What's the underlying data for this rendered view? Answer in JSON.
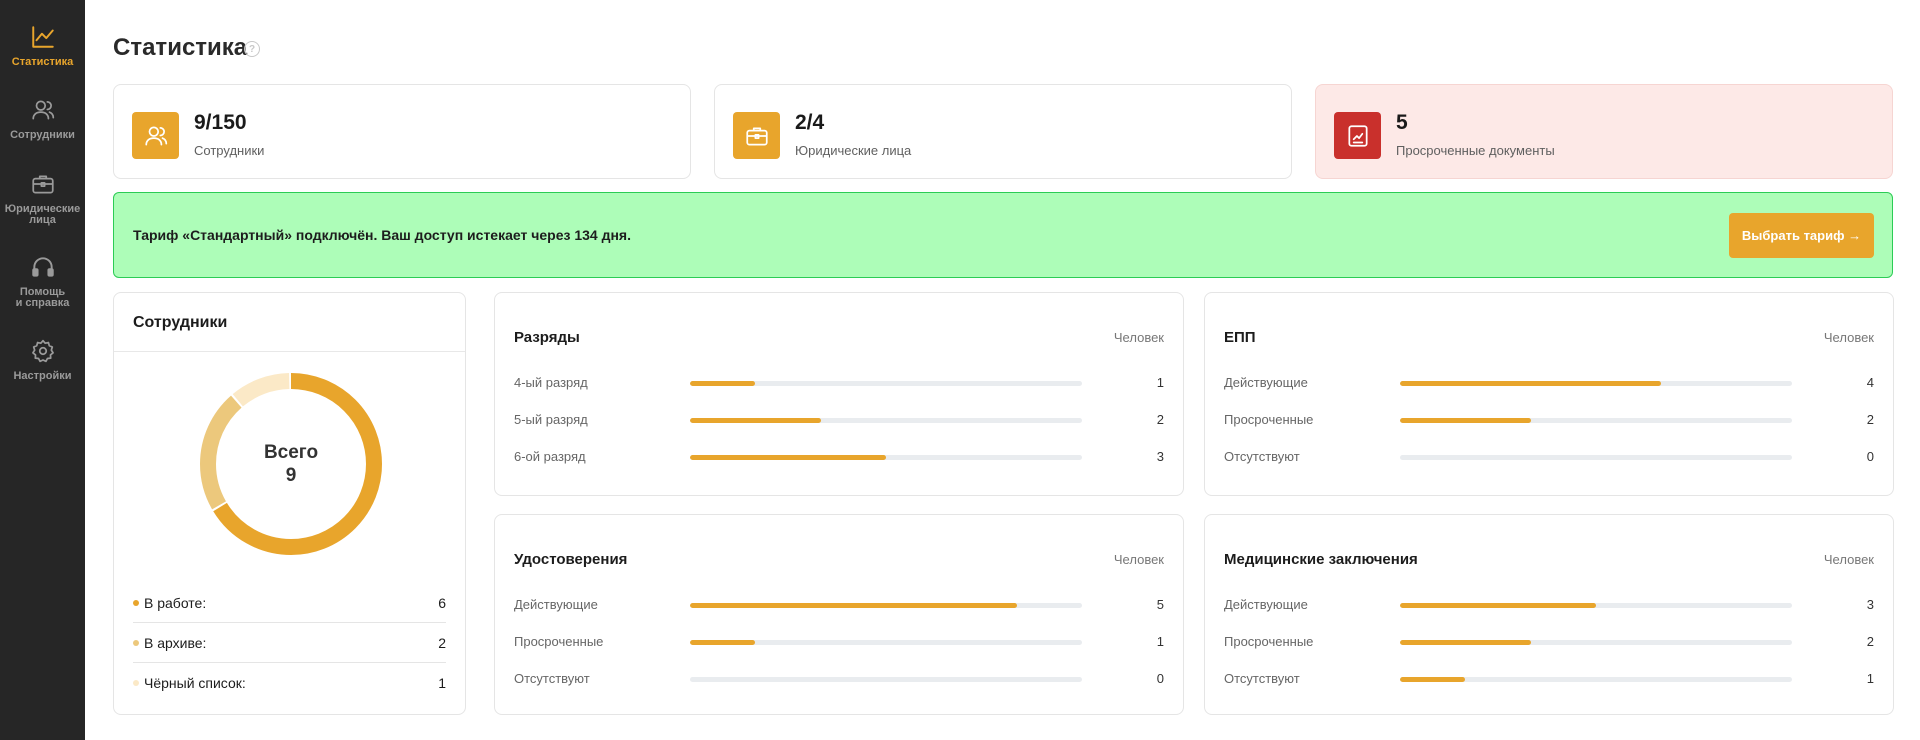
{
  "sidebar": {
    "items": [
      {
        "label": "Статистика",
        "icon": "chart-line-icon",
        "active": true
      },
      {
        "label": "Сотрудники",
        "icon": "users-icon",
        "active": false
      },
      {
        "label": "Юридические\nлица",
        "icon": "briefcase-icon",
        "active": false
      },
      {
        "label": "Помощь\nи справка",
        "icon": "headphones-icon",
        "active": false
      },
      {
        "label": "Настройки",
        "icon": "gear-icon",
        "active": false
      }
    ]
  },
  "page": {
    "title": "Статистика",
    "help": "?"
  },
  "stats": [
    {
      "value": "9/150",
      "label": "Сотрудники",
      "icon": "users-icon"
    },
    {
      "value": "2/4",
      "label": "Юридические лица",
      "icon": "briefcase-icon"
    },
    {
      "value": "5",
      "label": "Просроченные документы",
      "icon": "document-alert-icon"
    }
  ],
  "banner": {
    "text": "Тариф «Стандартный» подключён. Ваш доступ истекает через 134 дня.",
    "button": "Выбрать тариф →"
  },
  "employees": {
    "title": "Сотрудники",
    "total_label": "Всего",
    "total": 9,
    "legend": [
      {
        "label": "В работе:",
        "value": 6,
        "color": "#e8a52c"
      },
      {
        "label": "В архиве:",
        "value": 2,
        "color": "#ecc87c"
      },
      {
        "label": "Чёрный список:",
        "value": 1,
        "color": "#fbe9c7"
      }
    ]
  },
  "cards": [
    {
      "title": "Разряды",
      "unit": "Человек",
      "max": 6,
      "rows": [
        {
          "label": "4-ый разряд",
          "value": 1
        },
        {
          "label": "5-ый разряд",
          "value": 2
        },
        {
          "label": "6-ой разряд",
          "value": 3
        }
      ]
    },
    {
      "title": "ЕПП",
      "unit": "Человек",
      "max": 6,
      "rows": [
        {
          "label": "Действующие",
          "value": 4
        },
        {
          "label": "Просроченные",
          "value": 2
        },
        {
          "label": "Отсутствуют",
          "value": 0
        }
      ]
    },
    {
      "title": "Удостоверения",
      "unit": "Человек",
      "max": 6,
      "rows": [
        {
          "label": "Действующие",
          "value": 5
        },
        {
          "label": "Просроченные",
          "value": 1
        },
        {
          "label": "Отсутствуют",
          "value": 0
        }
      ]
    },
    {
      "title": "Медицинские заключения",
      "unit": "Человек",
      "max": 6,
      "rows": [
        {
          "label": "Действующие",
          "value": 3
        },
        {
          "label": "Просроченные",
          "value": 2
        },
        {
          "label": "Отсутствуют",
          "value": 1
        }
      ]
    }
  ],
  "colors": {
    "accent": "#e8a52c",
    "danger": "#c9302c",
    "success_bg": "#adfdb8",
    "success_border": "#2ccc55",
    "sidebar_bg": "#262626"
  }
}
